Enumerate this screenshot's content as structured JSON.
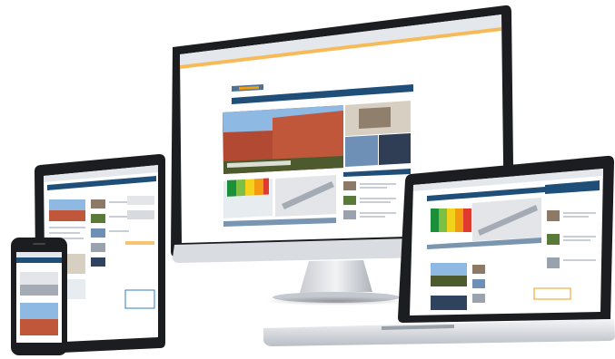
{
  "scene": {
    "devices": [
      "desktop-monitor",
      "laptop",
      "tablet",
      "smartphone"
    ]
  },
  "website": {
    "logo": "",
    "nav_items": [
      "",
      "",
      "",
      "",
      ""
    ]
  }
}
